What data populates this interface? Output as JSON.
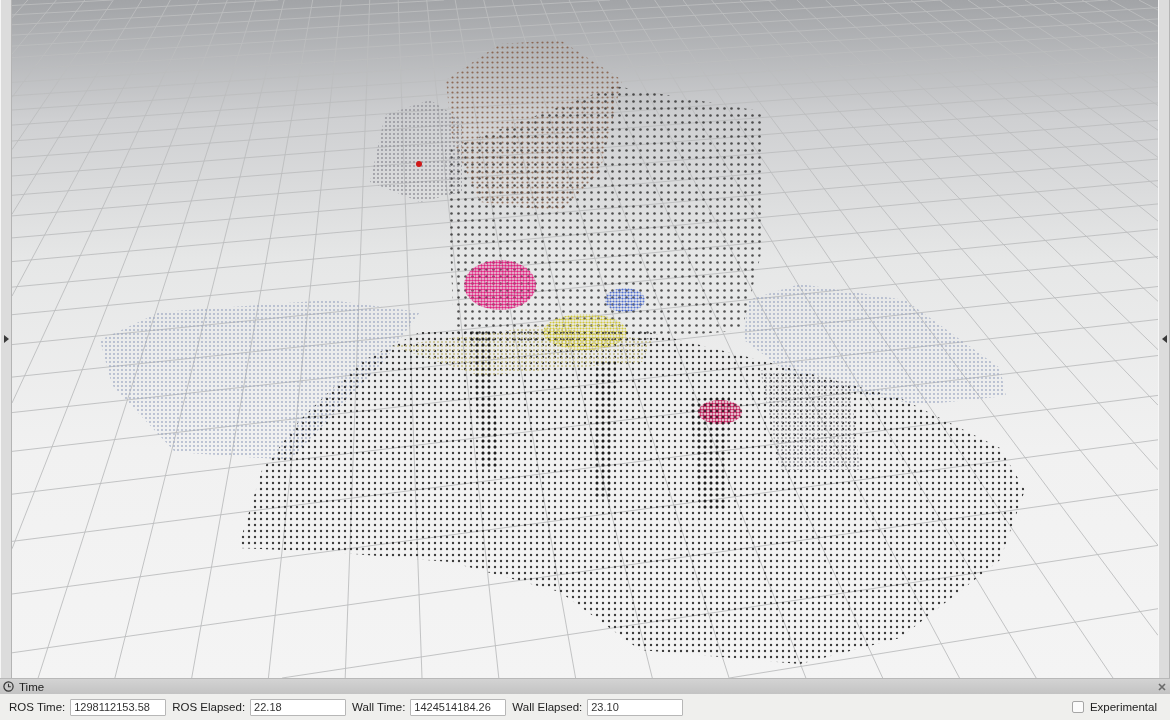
{
  "panel": {
    "title": "Time",
    "fields": [
      {
        "label": "ROS Time:",
        "value": "1298112153.58"
      },
      {
        "label": "ROS Elapsed:",
        "value": "22.18"
      },
      {
        "label": "Wall Time:",
        "value": "1424514184.26"
      },
      {
        "label": "Wall Elapsed:",
        "value": "23.10"
      }
    ],
    "experimental": {
      "label": "Experimental",
      "checked": false
    }
  }
}
